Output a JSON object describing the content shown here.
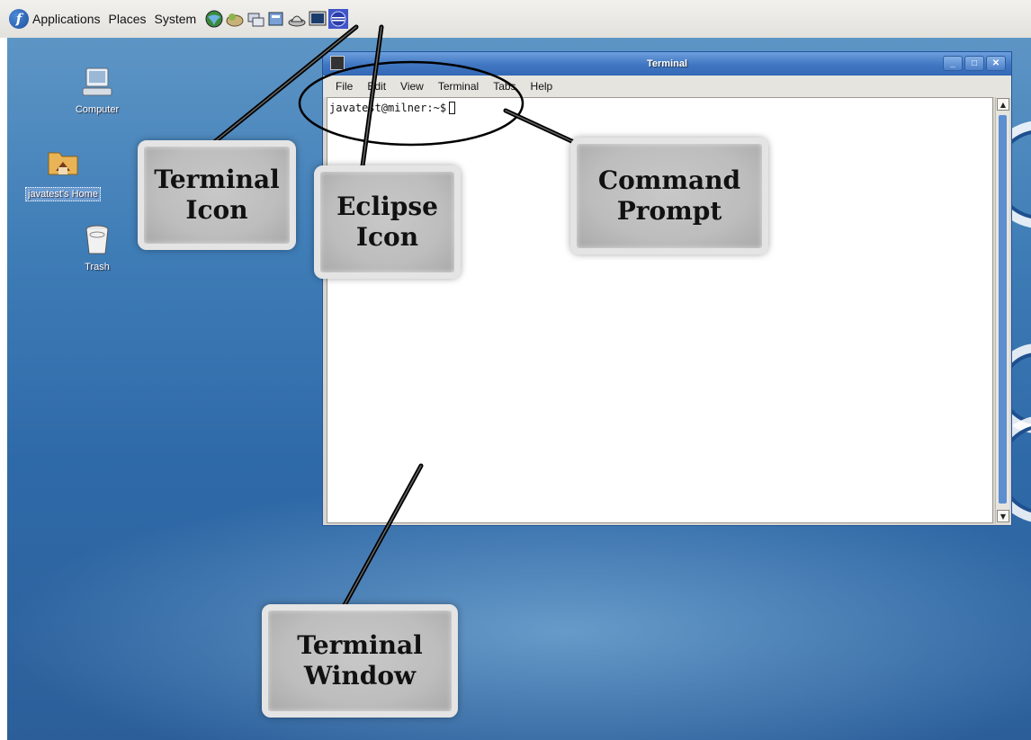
{
  "top_panel": {
    "logo": "f",
    "menus": [
      "Applications",
      "Places",
      "System"
    ],
    "launchers": [
      "web-browser-icon",
      "email-icon",
      "network-icon",
      "files-icon",
      "hat-icon",
      "terminal-icon",
      "eclipse-icon"
    ]
  },
  "desktop": {
    "icons": [
      {
        "label": "Computer",
        "icon": "computer-icon"
      },
      {
        "label": "javatest's Home",
        "icon": "home-folder-icon"
      },
      {
        "label": "Trash",
        "icon": "trash-icon"
      }
    ]
  },
  "terminal_window": {
    "title": "Terminal",
    "menus": [
      "File",
      "Edit",
      "View",
      "Terminal",
      "Tabs",
      "Help"
    ],
    "prompt": "javatest@milner:~$",
    "window_buttons": [
      "minimize",
      "maximize",
      "close"
    ]
  },
  "callouts": {
    "terminal_icon": [
      "Terminal",
      "Icon"
    ],
    "eclipse_icon": [
      "Eclipse",
      "Icon"
    ],
    "command_prompt": [
      "Command",
      "Prompt"
    ],
    "terminal_window": [
      "Terminal",
      "Window"
    ]
  },
  "colors": {
    "desktop": "#3f7db7",
    "titlebar": "#3f76c2",
    "panel": "#e9e7e3",
    "callout": "#c2c2c2"
  }
}
